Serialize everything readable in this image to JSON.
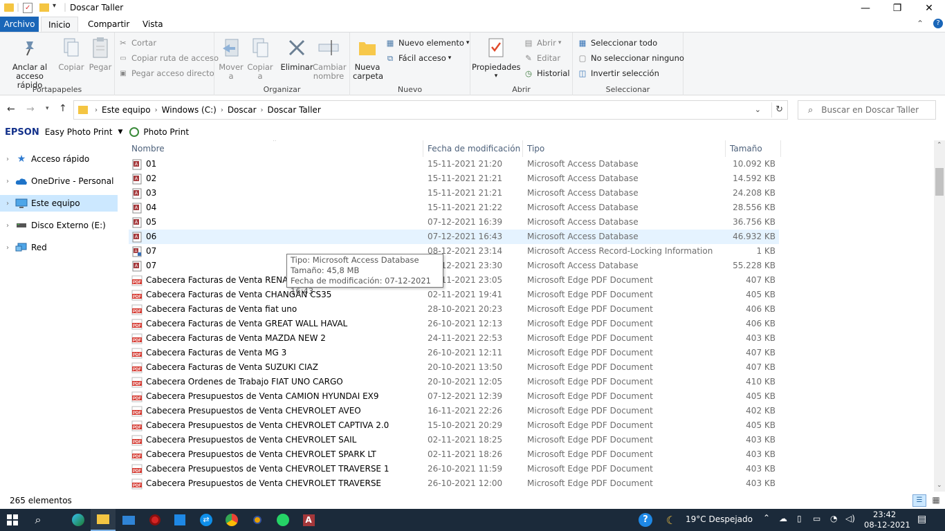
{
  "window": {
    "title": "Doscar Taller",
    "minimize_glyph": "—",
    "maximize_glyph": "❐",
    "close_glyph": "✕",
    "help_glyph": "?",
    "collapse_glyph": "⌃"
  },
  "ribbon_tabs": {
    "archivo": "Archivo",
    "inicio": "Inicio",
    "compartir": "Compartir",
    "vista": "Vista"
  },
  "ribbon": {
    "portapapeles": {
      "label": "Portapapeles",
      "anclar": "Anclar al\nacceso rápido",
      "copiar": "Copiar",
      "pegar": "Pegar",
      "cortar": "Cortar",
      "copiar_ruta": "Copiar ruta de acceso",
      "pegar_acceso": "Pegar acceso directo"
    },
    "organizar": {
      "label": "Organizar",
      "mover": "Mover\na",
      "copiar_a": "Copiar\na",
      "eliminar": "Eliminar",
      "cambiar_nombre": "Cambiar\nnombre"
    },
    "nuevo": {
      "label": "Nuevo",
      "nueva_carpeta": "Nueva\ncarpeta",
      "nuevo_elemento": "Nuevo elemento",
      "facil_acceso": "Fácil acceso"
    },
    "abrir": {
      "label": "Abrir",
      "propiedades": "Propiedades",
      "abrir": "Abrir",
      "editar": "Editar",
      "historial": "Historial"
    },
    "seleccionar": {
      "label": "Seleccionar",
      "seleccionar_todo": "Seleccionar todo",
      "no_seleccionar": "No seleccionar ninguno",
      "invertir": "Invertir selección"
    }
  },
  "address": {
    "crumbs": [
      "Este equipo",
      "Windows (C:)",
      "Doscar",
      "Doscar Taller"
    ],
    "search_placeholder": "Buscar en Doscar Taller"
  },
  "epson": {
    "brand": "EPSON",
    "app": "Easy Photo Print",
    "photo_print": "Photo Print"
  },
  "nav_pane": {
    "items": [
      {
        "label": "Acceso rápido",
        "icon": "star-icon"
      },
      {
        "label": "OneDrive - Personal",
        "icon": "cloud-icon"
      },
      {
        "label": "Este equipo",
        "icon": "computer-icon"
      },
      {
        "label": "Disco Externo (E:)",
        "icon": "drive-icon"
      },
      {
        "label": "Red",
        "icon": "network-icon"
      }
    ]
  },
  "columns": {
    "name": "Nombre",
    "date": "Fecha de modificación",
    "type": "Tipo",
    "size": "Tamaño"
  },
  "files": [
    {
      "name": "01",
      "date": "15-11-2021 21:20",
      "type": "Microsoft Access Database",
      "size": "10.092 KB",
      "icon": "access-db-icon"
    },
    {
      "name": "02",
      "date": "15-11-2021 21:21",
      "type": "Microsoft Access Database",
      "size": "14.592 KB",
      "icon": "access-db-icon"
    },
    {
      "name": "03",
      "date": "15-11-2021 21:21",
      "type": "Microsoft Access Database",
      "size": "24.208 KB",
      "icon": "access-db-icon"
    },
    {
      "name": "04",
      "date": "15-11-2021 21:22",
      "type": "Microsoft Access Database",
      "size": "28.556 KB",
      "icon": "access-db-icon"
    },
    {
      "name": "05",
      "date": "07-12-2021 16:39",
      "type": "Microsoft Access Database",
      "size": "36.756 KB",
      "icon": "access-db-icon"
    },
    {
      "name": "06",
      "date": "07-12-2021 16:43",
      "type": "Microsoft Access Database",
      "size": "46.932 KB",
      "icon": "access-db-icon"
    },
    {
      "name": "07",
      "date": "08-12-2021 23:14",
      "type": "Microsoft Access Record-Locking Information",
      "size": "1 KB",
      "icon": "lock-file-icon"
    },
    {
      "name": "07",
      "date": "08-12-2021 23:30",
      "type": "Microsoft Access Database",
      "size": "55.228 KB",
      "icon": "access-db-icon"
    },
    {
      "name": "Cabecera Facturas de Venta  RENAULT",
      "date": "08-11-2021 23:05",
      "type": "Microsoft Edge PDF Document",
      "size": "407 KB",
      "icon": "pdf-icon"
    },
    {
      "name": "Cabecera Facturas de Venta CHANGAN CS35",
      "date": "02-11-2021 19:41",
      "type": "Microsoft Edge PDF Document",
      "size": "405 KB",
      "icon": "pdf-icon"
    },
    {
      "name": "Cabecera Facturas de Venta fiat uno",
      "date": "28-10-2021 20:23",
      "type": "Microsoft Edge PDF Document",
      "size": "406 KB",
      "icon": "pdf-icon"
    },
    {
      "name": "Cabecera Facturas de Venta GREAT WALL HAVAL",
      "date": "26-10-2021 12:13",
      "type": "Microsoft Edge PDF Document",
      "size": "406 KB",
      "icon": "pdf-icon"
    },
    {
      "name": "Cabecera Facturas de Venta MAZDA NEW 2",
      "date": "24-11-2021 22:53",
      "type": "Microsoft Edge PDF Document",
      "size": "403 KB",
      "icon": "pdf-icon"
    },
    {
      "name": "Cabecera Facturas de Venta MG 3",
      "date": "26-10-2021 12:11",
      "type": "Microsoft Edge PDF Document",
      "size": "407 KB",
      "icon": "pdf-icon"
    },
    {
      "name": "Cabecera Facturas de Venta SUZUKI CIAZ",
      "date": "20-10-2021 13:50",
      "type": "Microsoft Edge PDF Document",
      "size": "407 KB",
      "icon": "pdf-icon"
    },
    {
      "name": "Cabecera Ordenes de Trabajo FIAT UNO CARGO",
      "date": "20-10-2021 12:05",
      "type": "Microsoft Edge PDF Document",
      "size": "410 KB",
      "icon": "pdf-icon"
    },
    {
      "name": "Cabecera Presupuestos de Venta CAMION HYUNDAI EX9",
      "date": "07-12-2021 12:39",
      "type": "Microsoft Edge PDF Document",
      "size": "405 KB",
      "icon": "pdf-icon"
    },
    {
      "name": "Cabecera Presupuestos de Venta CHEVROLET AVEO",
      "date": "16-11-2021 22:26",
      "type": "Microsoft Edge PDF Document",
      "size": "402 KB",
      "icon": "pdf-icon"
    },
    {
      "name": "Cabecera Presupuestos de Venta CHEVROLET CAPTIVA 2.0",
      "date": "15-10-2021 20:29",
      "type": "Microsoft Edge PDF Document",
      "size": "405 KB",
      "icon": "pdf-icon"
    },
    {
      "name": "Cabecera Presupuestos de Venta CHEVROLET SAIL",
      "date": "02-11-2021 18:25",
      "type": "Microsoft Edge PDF Document",
      "size": "403 KB",
      "icon": "pdf-icon"
    },
    {
      "name": "Cabecera Presupuestos de Venta CHEVROLET SPARK LT",
      "date": "02-11-2021 18:26",
      "type": "Microsoft Edge PDF Document",
      "size": "403 KB",
      "icon": "pdf-icon"
    },
    {
      "name": "Cabecera Presupuestos de Venta CHEVROLET TRAVERSE 1",
      "date": "26-10-2021 11:59",
      "type": "Microsoft Edge PDF Document",
      "size": "403 KB",
      "icon": "pdf-icon"
    },
    {
      "name": "Cabecera Presupuestos de Venta CHEVROLET TRAVERSE",
      "date": "26-10-2021 12:00",
      "type": "Microsoft Edge PDF Document",
      "size": "403 KB",
      "icon": "pdf-icon"
    }
  ],
  "tooltip": {
    "line1": "Tipo: Microsoft Access Database",
    "line2": "Tamaño: 45,8 MB",
    "line3": "Fecha de modificación: 07-12-2021 16:43"
  },
  "status": {
    "count": "265 elementos"
  },
  "taskbar": {
    "weather": "19°C  Despejado",
    "time": "23:42",
    "date": "08-12-2021"
  },
  "colors": {
    "accent": "#1a66b8",
    "selected_nav": "#cce8ff",
    "hover_row": "#e5f3ff",
    "pdf_red": "#d4352c",
    "taskbar": "#1b2a3a"
  }
}
